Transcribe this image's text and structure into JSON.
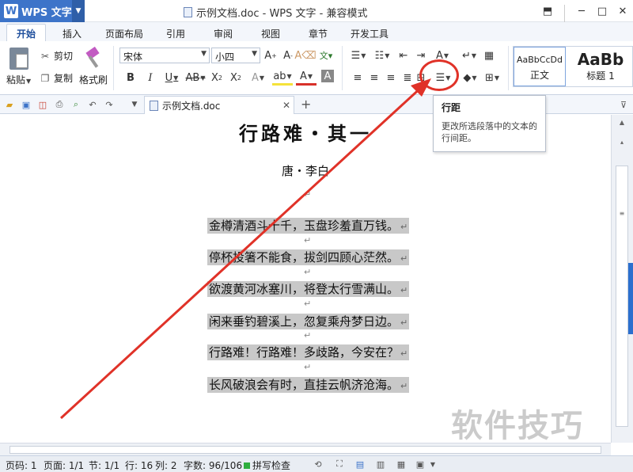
{
  "titlebar": {
    "app_logo": "W",
    "app_name": "WPS 文字",
    "doc_title": "示例文档.doc - WPS 文字 - 兼容模式"
  },
  "ribbon_tabs": [
    "开始",
    "插入",
    "页面布局",
    "引用",
    "审阅",
    "视图",
    "章节",
    "开发工具"
  ],
  "ribbon": {
    "paste": "粘贴",
    "cut": "剪切",
    "copy": "复制",
    "format_painter": "格式刷",
    "font_name": "宋体",
    "font_size": "小四",
    "styles": {
      "normal_sample": "AaBbCcDd",
      "normal_name": "正文",
      "heading1_sample": "AaBb",
      "heading1_name": "标题 1"
    }
  },
  "tooltip": {
    "title": "行距",
    "description": "更改所选段落中的文本的行间距。"
  },
  "quick_access": {
    "doc_tab": "示例文档.doc"
  },
  "document": {
    "title": "行路难・其一",
    "author": "唐・李白",
    "paragraph_mark": "↵",
    "lines": [
      "金樽清酒斗十千，玉盘珍羞直万钱。",
      "停杯投箸不能食，拔剑四顾心茫然。",
      "欲渡黄河冰塞川，将登太行雪满山。",
      "闲来垂钓碧溪上，忽复乘舟梦日边。",
      "行路难！行路难！多歧路，今安在？",
      "长风破浪会有时，直挂云帆济沧海。"
    ]
  },
  "watermark": "软件技巧",
  "statusbar": {
    "page_code": "页码: 1",
    "pages": "页面: 1/1",
    "section": "节: 1/1",
    "row": "行: 16",
    "col": "列: 2",
    "word_count": "字数: 96/106",
    "spell_check": "拼写检查"
  },
  "colors": {
    "accent": "#3d74c9",
    "highlight_circle": "#e03228",
    "selection": "#c8c8c8"
  }
}
